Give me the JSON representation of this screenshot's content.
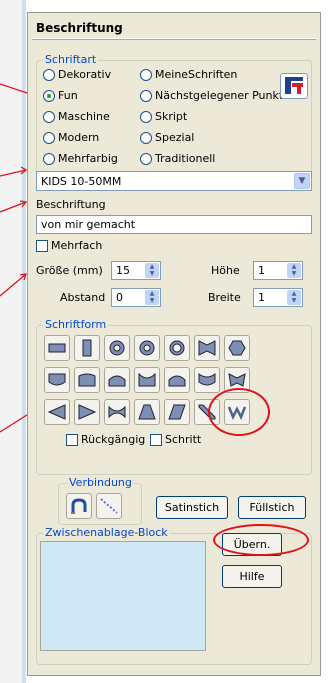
{
  "panel": {
    "title": "Beschriftung"
  },
  "font_group": {
    "legend": "Schriftart",
    "options": [
      {
        "label": "Dekorativ",
        "selected": false
      },
      {
        "label": "MeineSchriften",
        "selected": false
      },
      {
        "label": "Fun",
        "selected": true
      },
      {
        "label": "Nächstgelegener Punkt",
        "selected": false
      },
      {
        "label": "Maschine",
        "selected": false
      },
      {
        "label": "Skript",
        "selected": false
      },
      {
        "label": "Modern",
        "selected": false
      },
      {
        "label": "Spezial",
        "selected": false
      },
      {
        "label": "Mehrfarbig",
        "selected": false
      },
      {
        "label": "Traditionell",
        "selected": false
      }
    ],
    "font_select": "KIDS 10-50MM"
  },
  "lettering": {
    "label": "Beschriftung",
    "text": "von mir gemacht",
    "multi_label": "Mehrfach"
  },
  "size": {
    "size_label": "Größe (mm)",
    "size_value": "15",
    "height_label": "Höhe",
    "height_value": "1",
    "spacing_label": "Abstand",
    "spacing_value": "0",
    "width_label": "Breite",
    "width_value": "1"
  },
  "shape_group": {
    "legend": "Schriftform",
    "undo_label": "Rückgängig",
    "step_label": "Schritt"
  },
  "connection_group": {
    "legend": "Verbindung"
  },
  "buttons": {
    "satin": "Satinstich",
    "fill": "Füllstich",
    "apply": "Übern.",
    "help": "Hilfe"
  },
  "clipboard_group": {
    "legend": "Zwischenablage-Block"
  },
  "colors": {
    "annotation": "#e0121a",
    "legend": "#0046d5",
    "panel": "#ece9d8"
  }
}
